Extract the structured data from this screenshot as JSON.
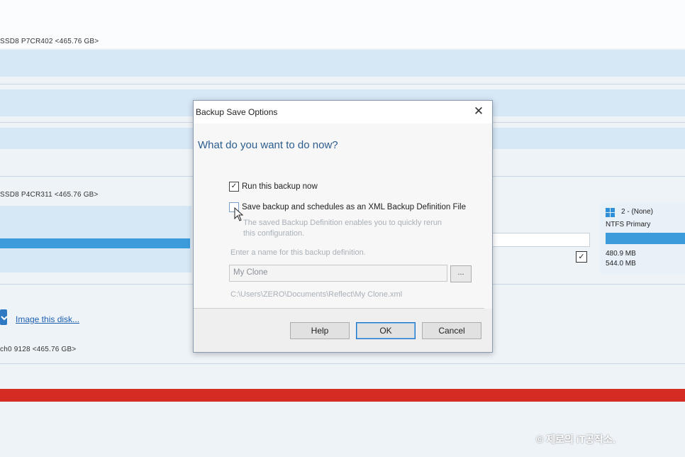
{
  "background": {
    "disk1_label": "SSD8 P7CR402  <465.76 GB>",
    "disk2_label": "SSD8 P4CR311  <465.76 GB>",
    "disk3_label": "ch0        9128  <465.76 GB>",
    "image_link": "Image this disk...",
    "partition": {
      "title": "2 - (None)",
      "type": "NTFS Primary",
      "used": "480.9 MB",
      "total": "544.0 MB"
    },
    "watermark": "© 제로의 iT공작소."
  },
  "dialog": {
    "title": "Backup Save Options",
    "question": "What do you want to do now?",
    "option_run": "Run this backup now",
    "option_run_checked": true,
    "option_save": "Save backup and schedules as an XML Backup Definition File",
    "option_save_checked": false,
    "save_description": "The saved Backup Definition enables you to quickly rerun this configuration.",
    "name_label": "Enter a name for this backup definition.",
    "name_value": "My Clone",
    "browse_label": "...",
    "path": "C:\\Users\\ZERO\\Documents\\Reflect\\My Clone.xml",
    "buttons": {
      "help": "Help",
      "ok": "OK",
      "cancel": "Cancel"
    }
  },
  "colors": {
    "accent_blue": "#3c9bdb",
    "question_text": "#2b5d8f",
    "red_bar": "#d42b22"
  }
}
